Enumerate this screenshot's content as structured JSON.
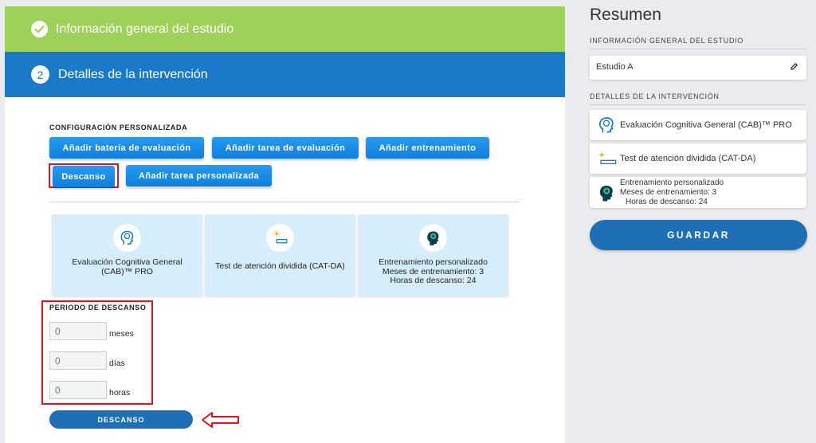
{
  "steps": {
    "completed": {
      "label": "Información general del estudio"
    },
    "active": {
      "number": "2",
      "label": "Detalles de la intervención"
    }
  },
  "config": {
    "title": "CONFIGURACIÓN PERSONALIZADA",
    "buttons": {
      "add_battery": "Añadir batería de evaluación",
      "add_task": "Añadir tarea de evaluación",
      "add_training": "Añadir entrenamiento",
      "rest": "Descanso",
      "add_custom_task": "Añadir tarea personalizada"
    }
  },
  "cards": [
    {
      "icon": "brain-head-icon",
      "line1": "Evaluación Cognitiva General",
      "line2": "(CAB)™ PRO",
      "line3": ""
    },
    {
      "icon": "divided-attention-icon",
      "line1": "Test de atención dividida (CAT-DA)",
      "line2": "",
      "line3": ""
    },
    {
      "icon": "training-head-icon",
      "line1": "Entrenamiento personalizado",
      "line2": "Meses de entrenamiento: 3",
      "line3": "Horas de descanso: 24"
    }
  ],
  "rest_period": {
    "title": "PERIODO DE DESCANSO",
    "fields": [
      {
        "value": "0",
        "unit": "meses"
      },
      {
        "value": "0",
        "unit": "días"
      },
      {
        "value": "0",
        "unit": "horas"
      }
    ],
    "button": "DESCANSO"
  },
  "summary": {
    "title": "Resumen",
    "section_general": "INFORMACIÓN GENERAL DEL ESTUDIO",
    "study_name": "Estudio A",
    "section_intervention": "DETALLES DE LA INTERVENCIÓN",
    "items": [
      {
        "icon": "brain-head-icon",
        "line1": "Evaluación Cognitiva General (CAB)™ PRO",
        "line2": "",
        "line3": ""
      },
      {
        "icon": "divided-attention-icon",
        "line1": "Test de atención dividida (CAT-DA)",
        "line2": "",
        "line3": ""
      },
      {
        "icon": "training-head-icon",
        "line1": "Entrenamiento personalizado",
        "line2": "Meses de entrenamiento: 3",
        "line3": "Horas de descanso: 24"
      }
    ],
    "save": "GUARDAR"
  },
  "colors": {
    "step_done": "#9ed15a",
    "step_active": "#1b79c9",
    "button_blue": "#1386e3",
    "highlight_red": "#e3121b",
    "card_bg": "#d6eefb",
    "dark_blue": "#1f6fb6"
  }
}
